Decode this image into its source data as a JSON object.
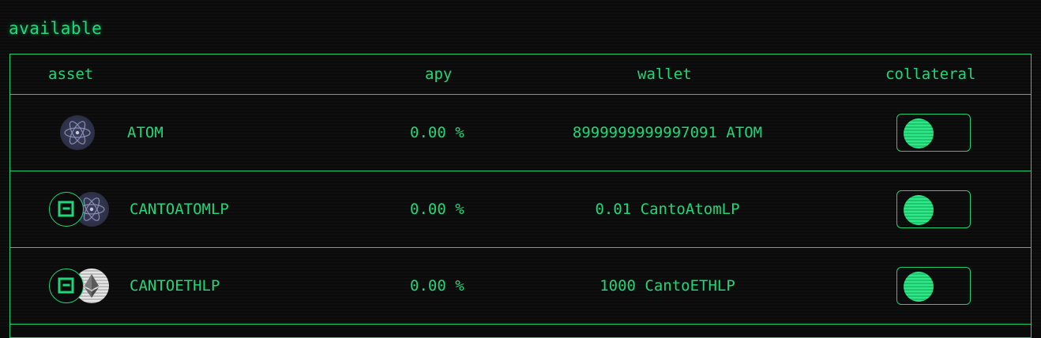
{
  "section": {
    "title": "available"
  },
  "table": {
    "headers": {
      "asset": "asset",
      "apy": "apy",
      "wallet": "wallet",
      "collateral": "collateral"
    },
    "rows": [
      {
        "asset": "ATOM",
        "apy": "0.00 %",
        "wallet": "8999999999997091 ATOM",
        "icons": [
          "atom-icon"
        ],
        "collateral_enabled": true
      },
      {
        "asset": "CANTOATOMLP",
        "apy": "0.00 %",
        "wallet": "0.01 CantoAtomLP",
        "icons": [
          "canto-icon",
          "atom-icon"
        ],
        "collateral_enabled": true
      },
      {
        "asset": "CANTOETHLP",
        "apy": "0.00 %",
        "wallet": "1000 CantoETHLP",
        "icons": [
          "canto-icon",
          "ethereum-icon"
        ],
        "collateral_enabled": true
      }
    ]
  },
  "colors": {
    "accent": "#1fd778",
    "background": "#0b0b0b"
  }
}
